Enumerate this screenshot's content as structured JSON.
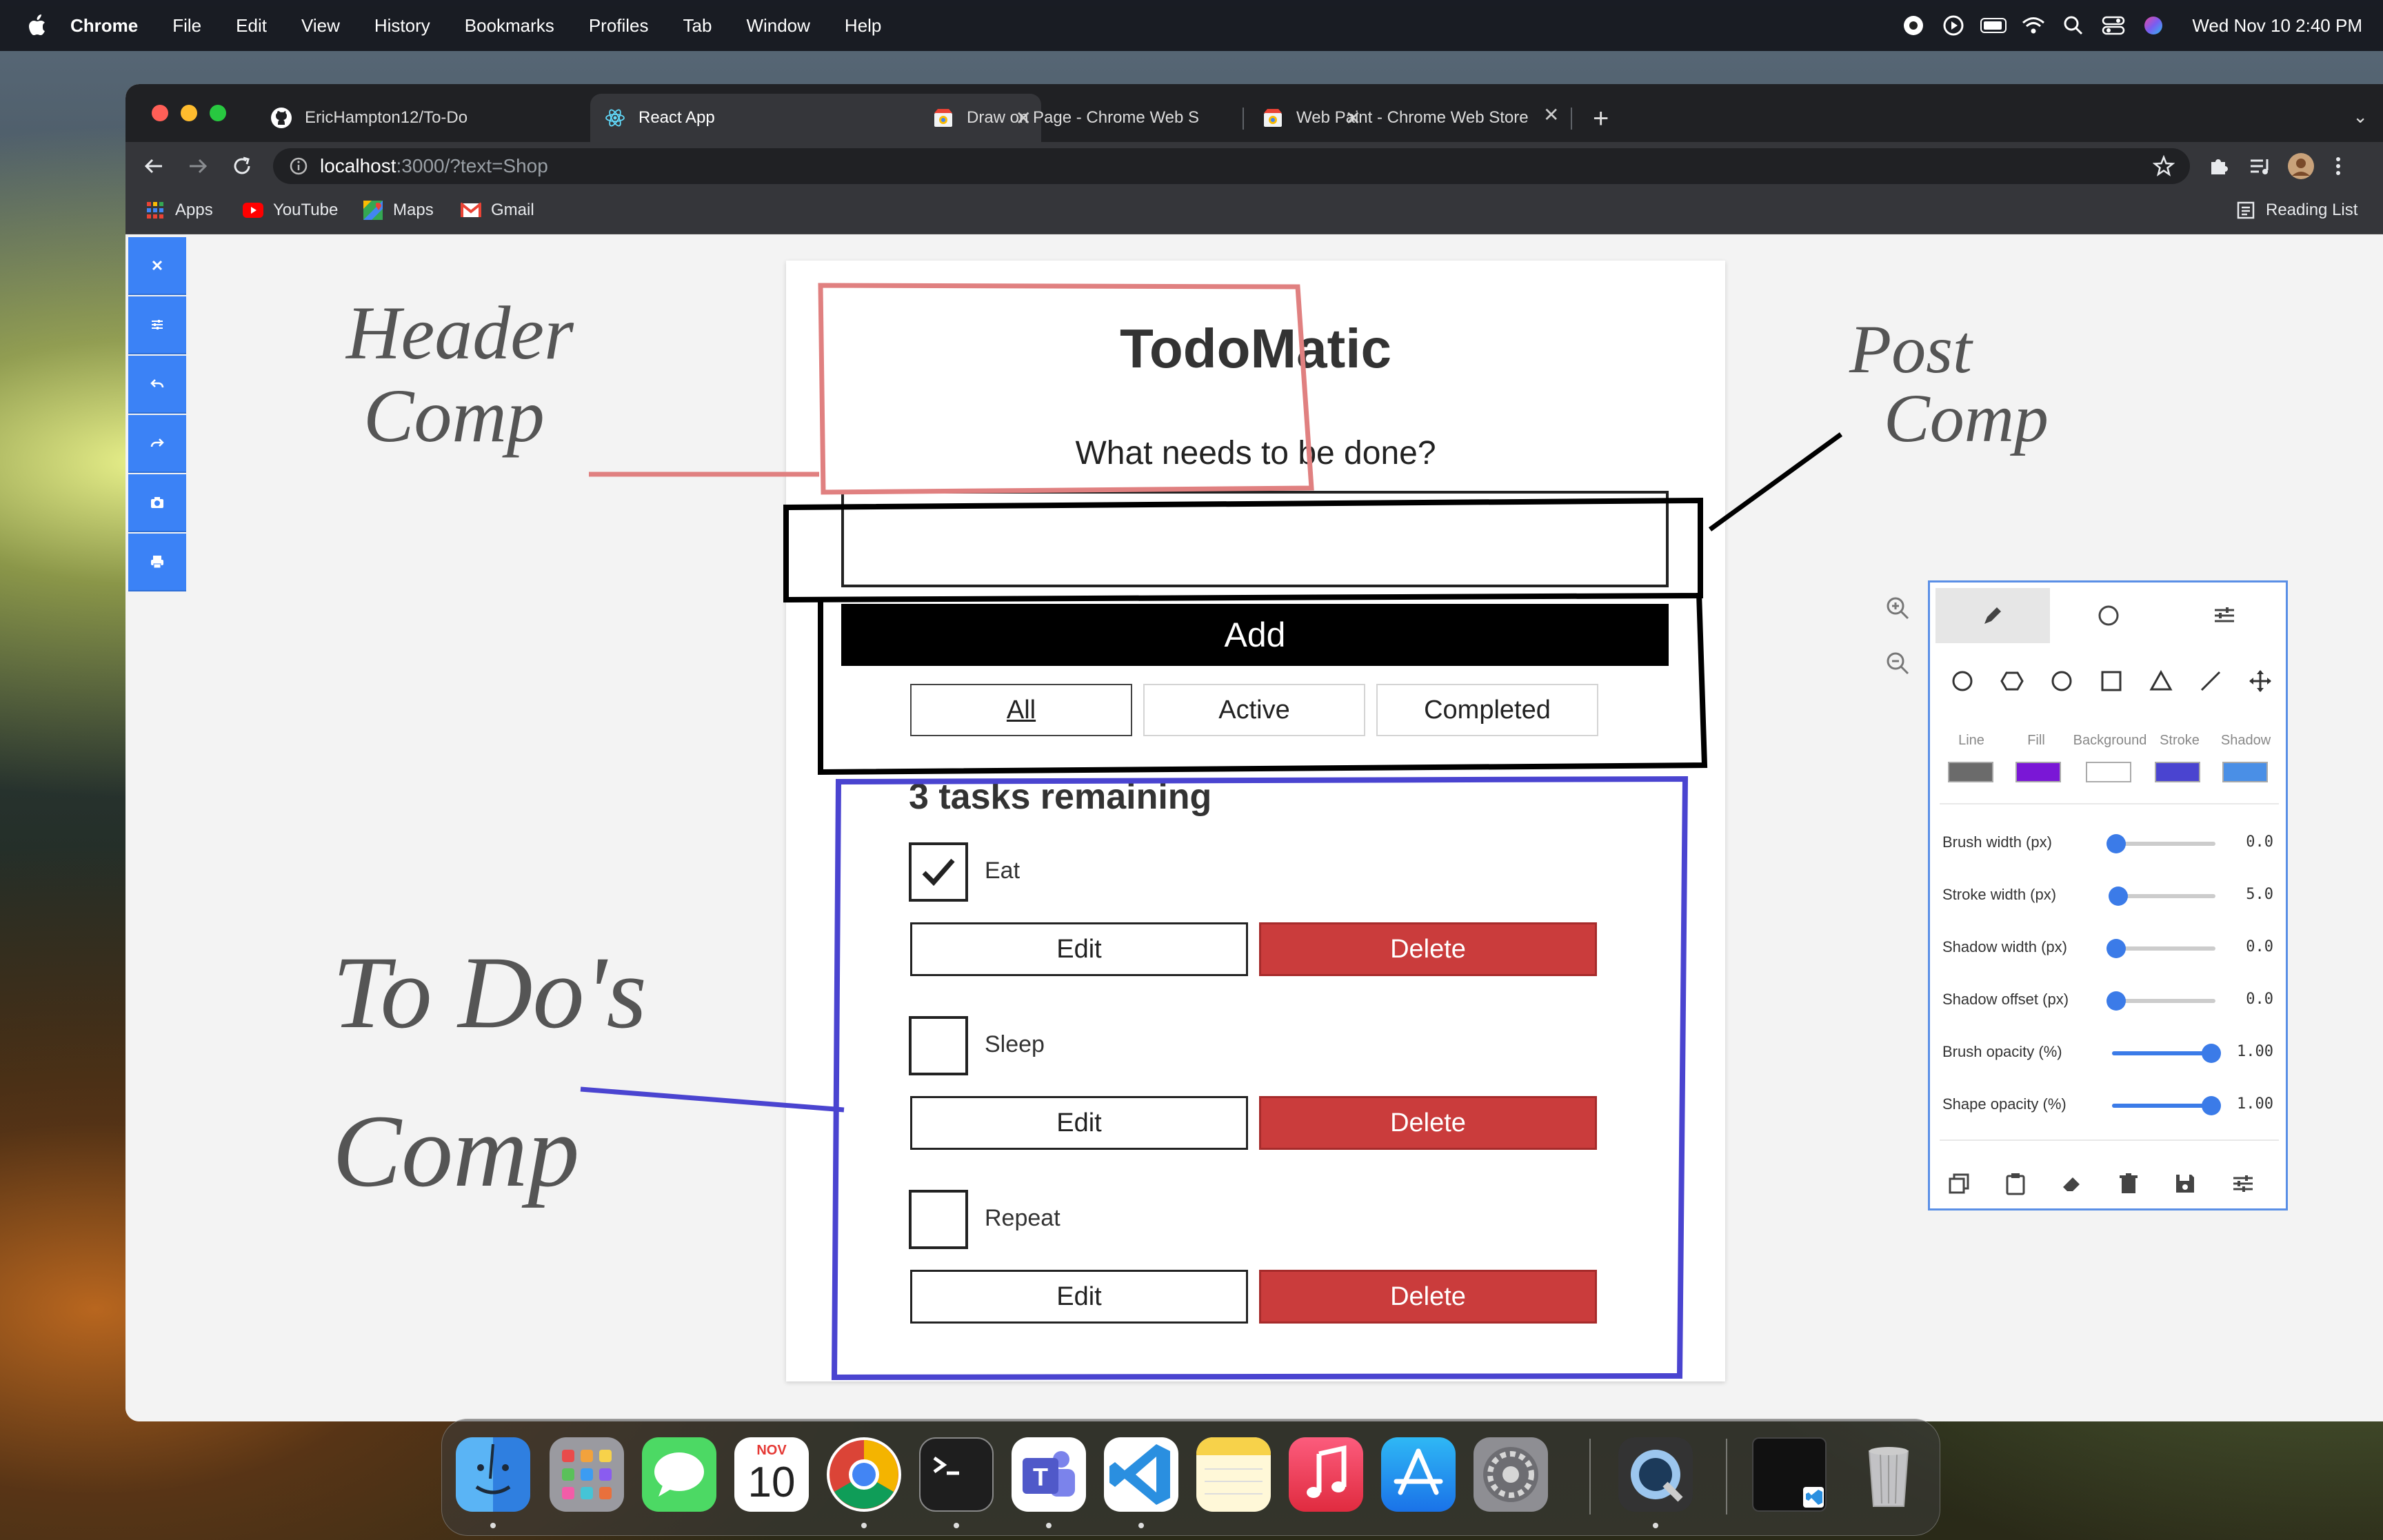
{
  "menubar": {
    "app": "Chrome",
    "items": [
      "File",
      "Edit",
      "View",
      "History",
      "Bookmarks",
      "Profiles",
      "Tab",
      "Window",
      "Help"
    ],
    "clock": "Wed Nov 10  2:40 PM",
    "status_icons": [
      "screen-record-icon",
      "play-icon",
      "battery-icon",
      "wifi-icon",
      "search-icon",
      "control-center-icon",
      "siri-icon"
    ]
  },
  "browser": {
    "tabs": [
      {
        "label": "EricHampton12/To-Do",
        "icon": "github-icon"
      },
      {
        "label": "React App",
        "icon": "react-icon",
        "active": true
      },
      {
        "label": "Draw on Page - Chrome Web S",
        "icon": "chrome-web-store-icon"
      },
      {
        "label": "Web Paint - Chrome Web Store",
        "icon": "chrome-web-store-icon"
      }
    ],
    "url_host": "localhost",
    "url_rest": ":3000/?text=Shop",
    "bookmarks": [
      {
        "label": "Apps",
        "icon": "apps-grid-icon"
      },
      {
        "label": "YouTube",
        "icon": "youtube-icon"
      },
      {
        "label": "Maps",
        "icon": "maps-icon"
      },
      {
        "label": "Gmail",
        "icon": "gmail-icon"
      }
    ],
    "reading_list": "Reading List"
  },
  "todo": {
    "title": "TodoMatic",
    "subtitle": "What needs to be done?",
    "input_value": "",
    "add_label": "Add",
    "filters": [
      {
        "label": "All",
        "pressed": true
      },
      {
        "label": "Active",
        "pressed": false
      },
      {
        "label": "Completed",
        "pressed": false
      }
    ],
    "heading": "3 tasks remaining",
    "tasks": [
      {
        "name": "Eat",
        "completed": true,
        "edit": "Edit",
        "delete": "Delete"
      },
      {
        "name": "Sleep",
        "completed": false,
        "edit": "Edit",
        "delete": "Delete"
      },
      {
        "name": "Repeat",
        "completed": false,
        "edit": "Edit",
        "delete": "Delete"
      }
    ]
  },
  "annotations": {
    "header": {
      "line1": "Header",
      "line2": "Comp",
      "color": "#e08080"
    },
    "post": {
      "line1": "Post",
      "line2": "Comp",
      "color": "#000000"
    },
    "todos": {
      "line1": "To Do's",
      "line2": "Comp",
      "color": "#4a44d0"
    }
  },
  "paint_panel": {
    "color_labels": [
      "Line",
      "Fill",
      "Background",
      "Stroke",
      "Shadow"
    ],
    "colors": {
      "line": "#6b6b6b",
      "fill": "#7a17d6",
      "background": "#ffffff",
      "stroke": "#4a44d0",
      "shadow": "#4a8fe6"
    },
    "sliders": [
      {
        "label": "Brush width (px)",
        "value": "0.0",
        "fraction": 0.0
      },
      {
        "label": "Stroke width (px)",
        "value": "5.0",
        "fraction": 0.02
      },
      {
        "label": "Shadow width (px)",
        "value": "0.0",
        "fraction": 0.0
      },
      {
        "label": "Shadow offset (px)",
        "value": "0.0",
        "fraction": 0.0
      },
      {
        "label": "Brush opacity (%)",
        "value": "1.00",
        "fraction": 1.0
      },
      {
        "label": "Shape opacity (%)",
        "value": "1.00",
        "fraction": 1.0
      }
    ]
  },
  "dock": {
    "apps": [
      "finder-icon",
      "launchpad-icon",
      "messages-icon",
      "calendar-icon",
      "chrome-icon",
      "terminal-icon",
      "teams-icon",
      "vscode-icon",
      "notes-icon",
      "music-icon",
      "app-store-icon",
      "system-preferences-icon",
      "quicktime-icon",
      "window-preview-icon",
      "trash-icon"
    ],
    "calendar_month": "NOV",
    "calendar_day": "10"
  }
}
